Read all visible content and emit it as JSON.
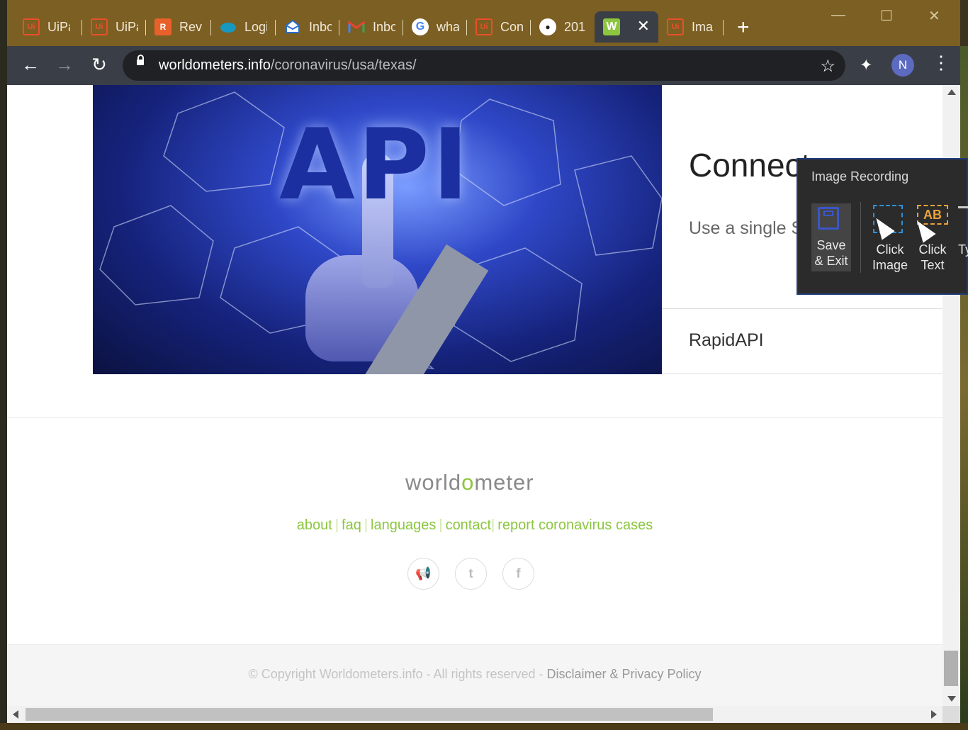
{
  "browser": {
    "tabs": [
      {
        "label": "UiPath",
        "icon": "uipath-icon"
      },
      {
        "label": "UiPath",
        "icon": "uipath-icon"
      },
      {
        "label": "Review",
        "icon": "r-app-icon"
      },
      {
        "label": "Login",
        "icon": "salesforce-cloud-icon"
      },
      {
        "label": "Inbox",
        "icon": "mail-envelope-icon"
      },
      {
        "label": "Inbox",
        "icon": "gmail-icon"
      },
      {
        "label": "what",
        "icon": "google-icon"
      },
      {
        "label": "Cont",
        "icon": "uipath-icon"
      },
      {
        "label": "201",
        "icon": "github-icon"
      },
      {
        "label": "",
        "icon": "worldometer-icon",
        "active": true
      },
      {
        "label": "Ima",
        "icon": "uipath-icon"
      }
    ],
    "new_tab": "+",
    "url_domain": "worldometers.info",
    "url_path": "/coronavirus/usa/texas/",
    "profile_initial": "N"
  },
  "colors": {
    "tab_bar": "#7c5f22",
    "toolbar": "#3a3f47",
    "worldometer_green": "#8cc63f",
    "uipath_orange": "#e8502a"
  },
  "promo": {
    "image_text": "API",
    "title": "Connect",
    "subtitle": "Use a single S",
    "provider": "RapidAPI"
  },
  "footer": {
    "logo_prefix": "world",
    "logo_o": "o",
    "logo_suffix": "meter",
    "links": [
      "about",
      "faq",
      "languages",
      "contact",
      "report coronavirus cases"
    ],
    "social_icons": [
      "megaphone-icon",
      "twitter-icon",
      "facebook-icon"
    ],
    "copyright": "© Copyright Worldometers.info - All rights reserved - ",
    "disclaimer": "Disclaimer & Privacy Policy"
  },
  "recorder": {
    "title": "Image Recording",
    "save_exit_line1": "Save",
    "save_exit_line2": "& Exit",
    "click_image_line1": "Click",
    "click_image_line2": "Image",
    "click_text_line1": "Click",
    "click_text_line2": "Text",
    "type_partial": "Ty",
    "click_text_icon_label": "AB"
  }
}
